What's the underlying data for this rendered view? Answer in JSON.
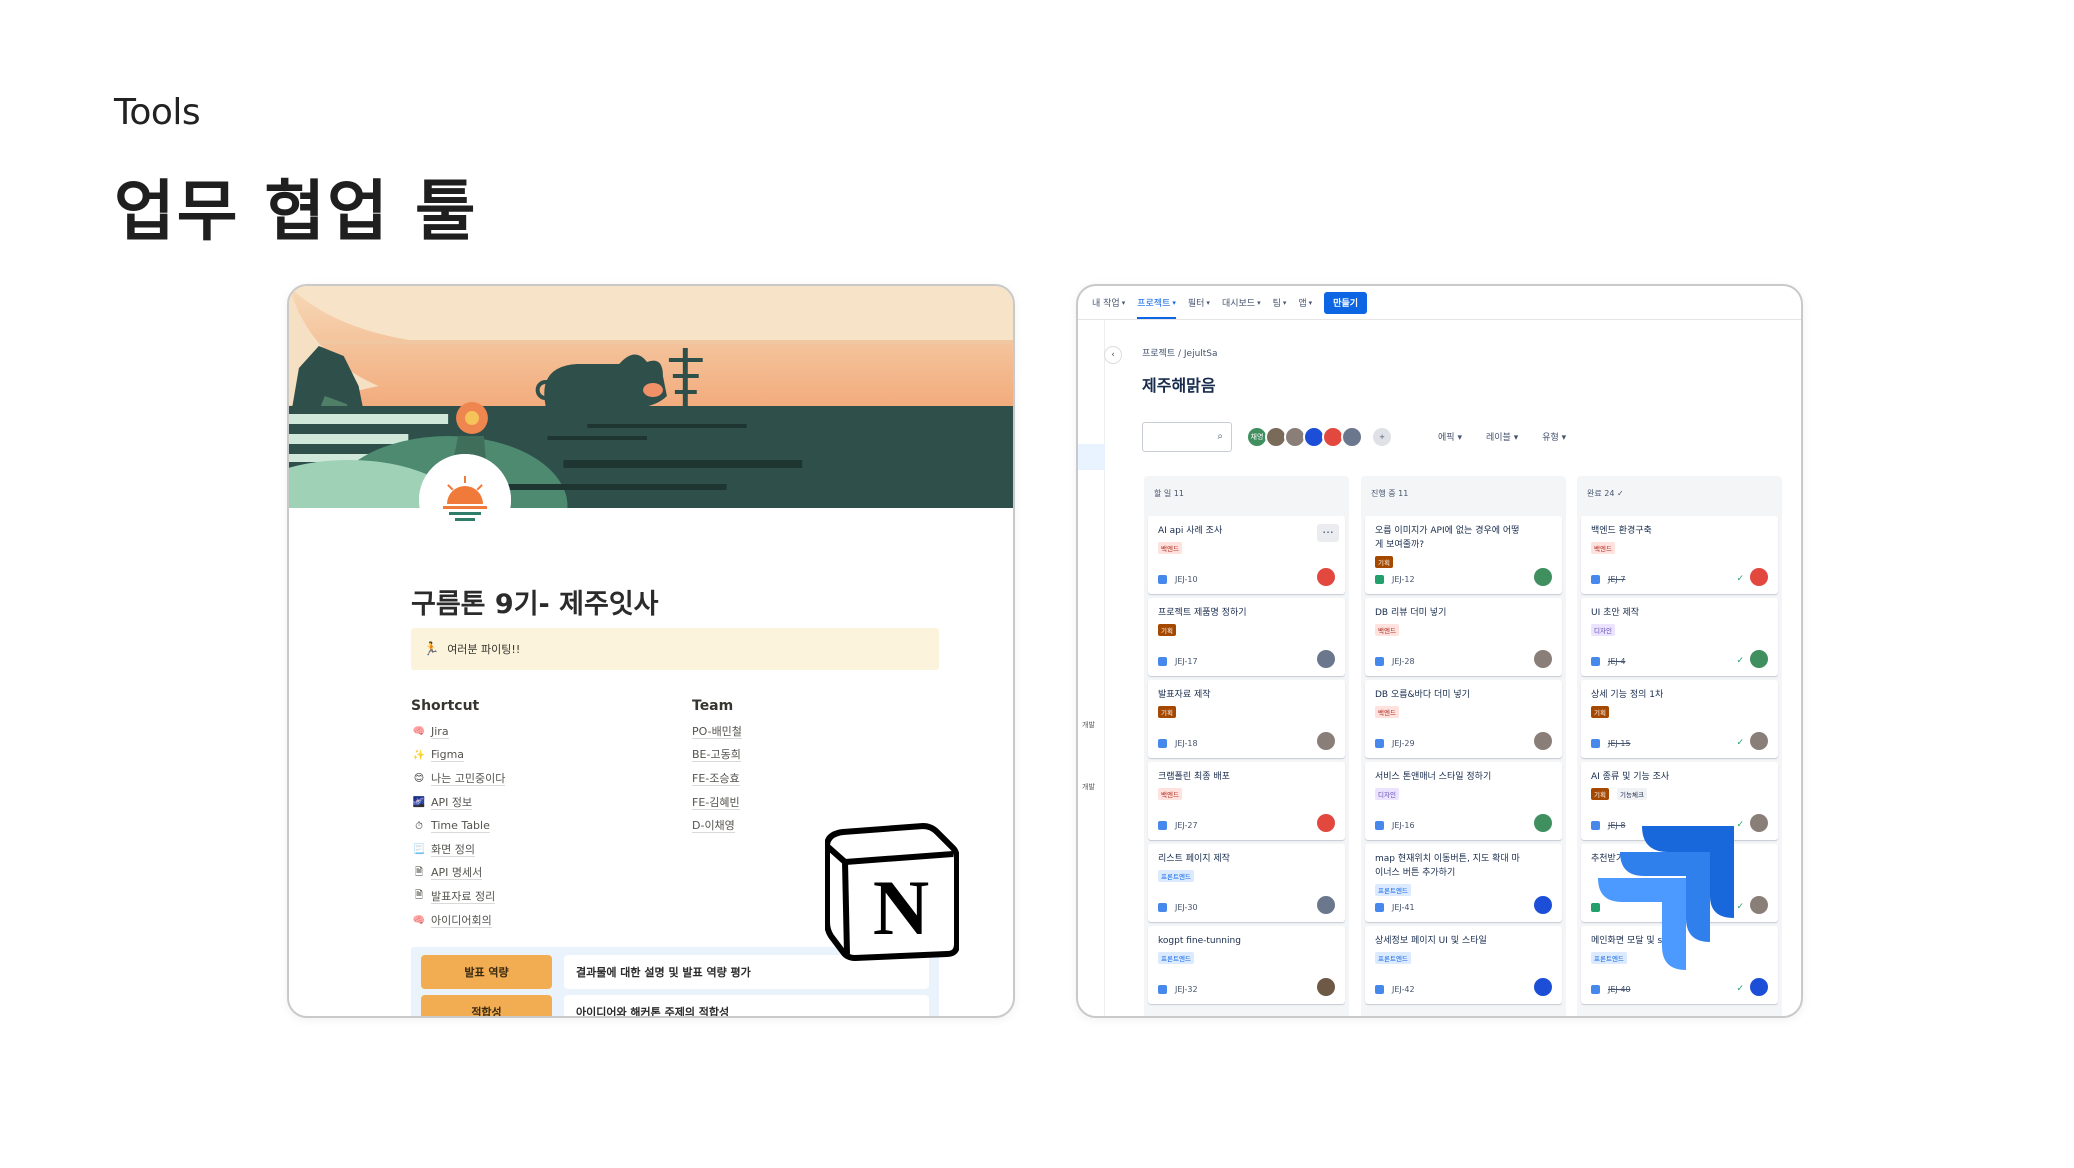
{
  "slide": {
    "kicker": "Tools",
    "title": "업무 협업 툴"
  },
  "notion": {
    "page_title": "구름톤 9기- 제주잇사",
    "callout": {
      "icon": "runner-icon",
      "text": "여러분 파이팅!!"
    },
    "shortcut_heading": "Shortcut",
    "shortcuts": [
      {
        "icon": "brain-icon",
        "glyph": "🧠",
        "label": "Jira",
        "style": "link"
      },
      {
        "icon": "sparkle-icon",
        "glyph": "✨",
        "label": "Figma",
        "style": "link"
      },
      {
        "icon": "smile-icon",
        "glyph": "😊",
        "label": "나는 고민중이다",
        "style": "page"
      },
      {
        "icon": "galaxy-icon",
        "glyph": "🌌",
        "label": "API 정보",
        "style": "page"
      },
      {
        "icon": "stopwatch-icon",
        "glyph": "⏱",
        "label": "Time Table",
        "style": "page"
      },
      {
        "icon": "document-icon",
        "glyph": "📃",
        "label": "화면 정의",
        "style": "page"
      },
      {
        "icon": "page-icon",
        "glyph": "🗎",
        "label": "API 명세서",
        "style": "page"
      },
      {
        "icon": "page-icon",
        "glyph": "🗎",
        "label": "발표자료 정리",
        "style": "page"
      },
      {
        "icon": "brain-icon",
        "glyph": "🧠",
        "label": "아이디어회의",
        "style": "page"
      }
    ],
    "team_heading": "Team",
    "team": [
      "PO-배민철",
      "BE-고동희",
      "FE-조승효",
      "FE-김혜빈",
      "D-이채영"
    ],
    "table_rows": [
      {
        "tag": "발표 역량",
        "desc": "결과물에 대한 설명 및 발표 역량 평가"
      },
      {
        "tag": "적합성",
        "desc": "아이디어와 해커톤 주제의 적합성"
      }
    ]
  },
  "jira": {
    "nav": [
      {
        "label": "내 작업",
        "active": false
      },
      {
        "label": "프로젝트",
        "active": true
      },
      {
        "label": "필터",
        "active": false
      },
      {
        "label": "대시보드",
        "active": false
      },
      {
        "label": "팀",
        "active": false
      },
      {
        "label": "앱",
        "active": false
      }
    ],
    "create_label": "만들기",
    "breadcrumb": "프로젝트  /  JejultSa",
    "board_title": "제주해맑음",
    "sidebar_labels": [
      "개발",
      "개발"
    ],
    "avatar_initial": "채영",
    "filters": [
      "에픽",
      "레이블",
      "유형"
    ],
    "columns": [
      {
        "title": "할 일 11",
        "cards": [
          {
            "title": "AI api 사례 조사",
            "label": "백엔드",
            "label_kind": "be",
            "key": "JEJ-10",
            "assignee": "red",
            "more": true
          },
          {
            "title": "프로젝트 제품명 정하기",
            "label": "기획",
            "label_kind": "plan",
            "key": "JEJ-17",
            "assignee": "gray"
          },
          {
            "title": "발표자료 제작",
            "label": "기획",
            "label_kind": "plan",
            "key": "JEJ-18",
            "assignee": "photo"
          },
          {
            "title": "크램폴린 최종 배포",
            "label": "백엔드",
            "label_kind": "be",
            "key": "JEJ-27",
            "assignee": "red"
          },
          {
            "title": "리스트 페이지 제작",
            "label": "프론트엔드",
            "label_kind": "fe",
            "key": "JEJ-30",
            "assignee": "gray"
          },
          {
            "title": "kogpt fine-tunning",
            "label": "프론트엔드",
            "label_kind": "fe",
            "key": "JEJ-32",
            "assignee": "brown"
          }
        ]
      },
      {
        "title": "진행 중 11",
        "cards": [
          {
            "title": "오름 이미지가 API에 없는 경우에 어떻게 보여줄까?",
            "label": "기획",
            "label_kind": "plan",
            "key": "JEJ-12",
            "assignee": "green",
            "story": true
          },
          {
            "title": "DB 리뷰 더미 넣기",
            "label": "백엔드",
            "label_kind": "be",
            "key": "JEJ-28",
            "assignee": "photo"
          },
          {
            "title": "DB 오름&바다 더미 넣기",
            "label": "백엔드",
            "label_kind": "be",
            "key": "JEJ-29",
            "assignee": "photo"
          },
          {
            "title": "서비스 톤앤매너 스타일 정하기",
            "label": "디자인",
            "label_kind": "design",
            "key": "JEJ-16",
            "assignee": "green"
          },
          {
            "title": "map 현재위치 이동버튼, 지도 확대 마이너스 버튼 추가하기",
            "label": "프론트엔드",
            "label_kind": "fe",
            "key": "JEJ-41",
            "assignee": "blue"
          },
          {
            "title": "상세정보 페이지 UI 및 스타일",
            "label": "프론트엔드",
            "label_kind": "fe",
            "key": "JEJ-42",
            "assignee": "blue"
          }
        ]
      },
      {
        "title": "완료 24",
        "done": true,
        "cards": [
          {
            "title": "백엔드 환경구축",
            "label": "백엔드",
            "label_kind": "be",
            "key": "JEJ-7",
            "assignee": "red"
          },
          {
            "title": "UI 초안 제작",
            "label": "디자인",
            "label_kind": "design",
            "key": "JEJ-4",
            "assignee": "green"
          },
          {
            "title": "상세 기능 정의 1차",
            "label": "기획",
            "label_kind": "plan",
            "key": "JEJ-15",
            "assignee": "photo"
          },
          {
            "title": "AI 종류 및 기능 조사",
            "label": "기획",
            "label_kind": "plan",
            "label2": "기능체크",
            "key": "JEJ-8",
            "assignee": "photo"
          },
          {
            "title": "추천받기 페이지 이 있어야",
            "label": "",
            "label_kind": "plan",
            "key": "",
            "assignee": "photo",
            "story": true
          },
          {
            "title": "메인화면 모달 및 style",
            "label": "프론트엔드",
            "label_kind": "fe",
            "key": "JEJ-40",
            "assignee": "blue"
          }
        ]
      }
    ]
  },
  "colors": {
    "jira_blue": "#0c66e4",
    "notion_callout": "#fbf3db",
    "tag_orange": "#f2ac52",
    "label_be": "#ffe2dd",
    "label_plan": "#a54800",
    "label_fe": "#dbeaff",
    "label_design": "#ece3ff"
  }
}
